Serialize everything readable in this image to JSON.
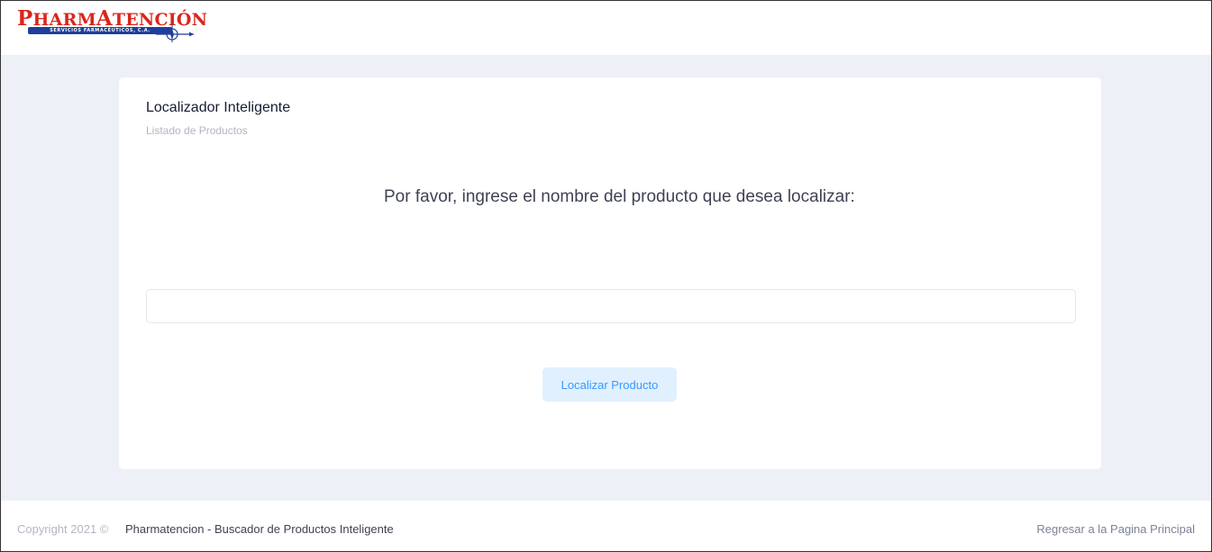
{
  "header": {
    "logo": {
      "text_initial_p": "P",
      "text_harm": "HARM",
      "text_initial_a": "A",
      "text_tencion": "TENCIÓN",
      "tagline": "SERVICIOS FARMACÉUTICOS, C.A.",
      "mark_icon": "compass-rose-icon",
      "primary_color": "#d9261c",
      "secondary_color": "#1f3f9a"
    }
  },
  "card": {
    "title": "Localizador Inteligente",
    "subtitle": "Listado de Productos",
    "prompt": "Por favor, ingrese el nombre del producto que desea localizar:",
    "search": {
      "value": "",
      "placeholder": ""
    },
    "locate_button_label": "Localizar Producto",
    "accent_color": "#3699ff"
  },
  "footer": {
    "copyright": "Copyright 2021 ©",
    "brand": "Pharmatencion - Buscador de Productos Inteligente",
    "home_link": "Regresar a la Pagina Principal"
  }
}
